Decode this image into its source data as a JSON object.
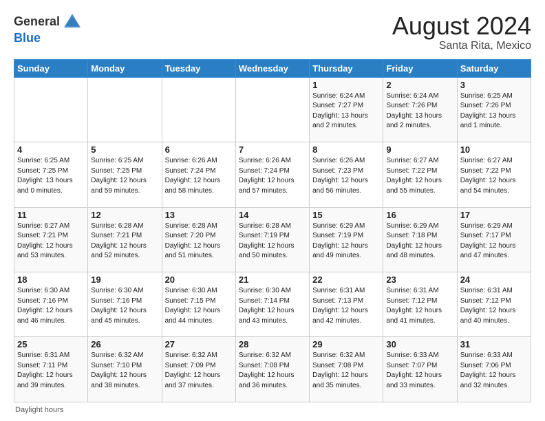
{
  "header": {
    "logo": {
      "line1": "General",
      "line2": "Blue"
    },
    "title": "August 2024",
    "subtitle": "Santa Rita, Mexico"
  },
  "days_of_week": [
    "Sunday",
    "Monday",
    "Tuesday",
    "Wednesday",
    "Thursday",
    "Friday",
    "Saturday"
  ],
  "weeks": [
    [
      {
        "day": "",
        "info": ""
      },
      {
        "day": "",
        "info": ""
      },
      {
        "day": "",
        "info": ""
      },
      {
        "day": "",
        "info": ""
      },
      {
        "day": "1",
        "info": "Sunrise: 6:24 AM\nSunset: 7:27 PM\nDaylight: 13 hours\nand 2 minutes."
      },
      {
        "day": "2",
        "info": "Sunrise: 6:24 AM\nSunset: 7:26 PM\nDaylight: 13 hours\nand 2 minutes."
      },
      {
        "day": "3",
        "info": "Sunrise: 6:25 AM\nSunset: 7:26 PM\nDaylight: 13 hours\nand 1 minute."
      }
    ],
    [
      {
        "day": "4",
        "info": "Sunrise: 6:25 AM\nSunset: 7:25 PM\nDaylight: 13 hours\nand 0 minutes."
      },
      {
        "day": "5",
        "info": "Sunrise: 6:25 AM\nSunset: 7:25 PM\nDaylight: 12 hours\nand 59 minutes."
      },
      {
        "day": "6",
        "info": "Sunrise: 6:26 AM\nSunset: 7:24 PM\nDaylight: 12 hours\nand 58 minutes."
      },
      {
        "day": "7",
        "info": "Sunrise: 6:26 AM\nSunset: 7:24 PM\nDaylight: 12 hours\nand 57 minutes."
      },
      {
        "day": "8",
        "info": "Sunrise: 6:26 AM\nSunset: 7:23 PM\nDaylight: 12 hours\nand 56 minutes."
      },
      {
        "day": "9",
        "info": "Sunrise: 6:27 AM\nSunset: 7:22 PM\nDaylight: 12 hours\nand 55 minutes."
      },
      {
        "day": "10",
        "info": "Sunrise: 6:27 AM\nSunset: 7:22 PM\nDaylight: 12 hours\nand 54 minutes."
      }
    ],
    [
      {
        "day": "11",
        "info": "Sunrise: 6:27 AM\nSunset: 7:21 PM\nDaylight: 12 hours\nand 53 minutes."
      },
      {
        "day": "12",
        "info": "Sunrise: 6:28 AM\nSunset: 7:21 PM\nDaylight: 12 hours\nand 52 minutes."
      },
      {
        "day": "13",
        "info": "Sunrise: 6:28 AM\nSunset: 7:20 PM\nDaylight: 12 hours\nand 51 minutes."
      },
      {
        "day": "14",
        "info": "Sunrise: 6:28 AM\nSunset: 7:19 PM\nDaylight: 12 hours\nand 50 minutes."
      },
      {
        "day": "15",
        "info": "Sunrise: 6:29 AM\nSunset: 7:19 PM\nDaylight: 12 hours\nand 49 minutes."
      },
      {
        "day": "16",
        "info": "Sunrise: 6:29 AM\nSunset: 7:18 PM\nDaylight: 12 hours\nand 48 minutes."
      },
      {
        "day": "17",
        "info": "Sunrise: 6:29 AM\nSunset: 7:17 PM\nDaylight: 12 hours\nand 47 minutes."
      }
    ],
    [
      {
        "day": "18",
        "info": "Sunrise: 6:30 AM\nSunset: 7:16 PM\nDaylight: 12 hours\nand 46 minutes."
      },
      {
        "day": "19",
        "info": "Sunrise: 6:30 AM\nSunset: 7:16 PM\nDaylight: 12 hours\nand 45 minutes."
      },
      {
        "day": "20",
        "info": "Sunrise: 6:30 AM\nSunset: 7:15 PM\nDaylight: 12 hours\nand 44 minutes."
      },
      {
        "day": "21",
        "info": "Sunrise: 6:30 AM\nSunset: 7:14 PM\nDaylight: 12 hours\nand 43 minutes."
      },
      {
        "day": "22",
        "info": "Sunrise: 6:31 AM\nSunset: 7:13 PM\nDaylight: 12 hours\nand 42 minutes."
      },
      {
        "day": "23",
        "info": "Sunrise: 6:31 AM\nSunset: 7:12 PM\nDaylight: 12 hours\nand 41 minutes."
      },
      {
        "day": "24",
        "info": "Sunrise: 6:31 AM\nSunset: 7:12 PM\nDaylight: 12 hours\nand 40 minutes."
      }
    ],
    [
      {
        "day": "25",
        "info": "Sunrise: 6:31 AM\nSunset: 7:11 PM\nDaylight: 12 hours\nand 39 minutes."
      },
      {
        "day": "26",
        "info": "Sunrise: 6:32 AM\nSunset: 7:10 PM\nDaylight: 12 hours\nand 38 minutes."
      },
      {
        "day": "27",
        "info": "Sunrise: 6:32 AM\nSunset: 7:09 PM\nDaylight: 12 hours\nand 37 minutes."
      },
      {
        "day": "28",
        "info": "Sunrise: 6:32 AM\nSunset: 7:08 PM\nDaylight: 12 hours\nand 36 minutes."
      },
      {
        "day": "29",
        "info": "Sunrise: 6:32 AM\nSunset: 7:08 PM\nDaylight: 12 hours\nand 35 minutes."
      },
      {
        "day": "30",
        "info": "Sunrise: 6:33 AM\nSunset: 7:07 PM\nDaylight: 12 hours\nand 33 minutes."
      },
      {
        "day": "31",
        "info": "Sunrise: 6:33 AM\nSunset: 7:06 PM\nDaylight: 12 hours\nand 32 minutes."
      }
    ]
  ],
  "footer": {
    "note": "Daylight hours"
  }
}
